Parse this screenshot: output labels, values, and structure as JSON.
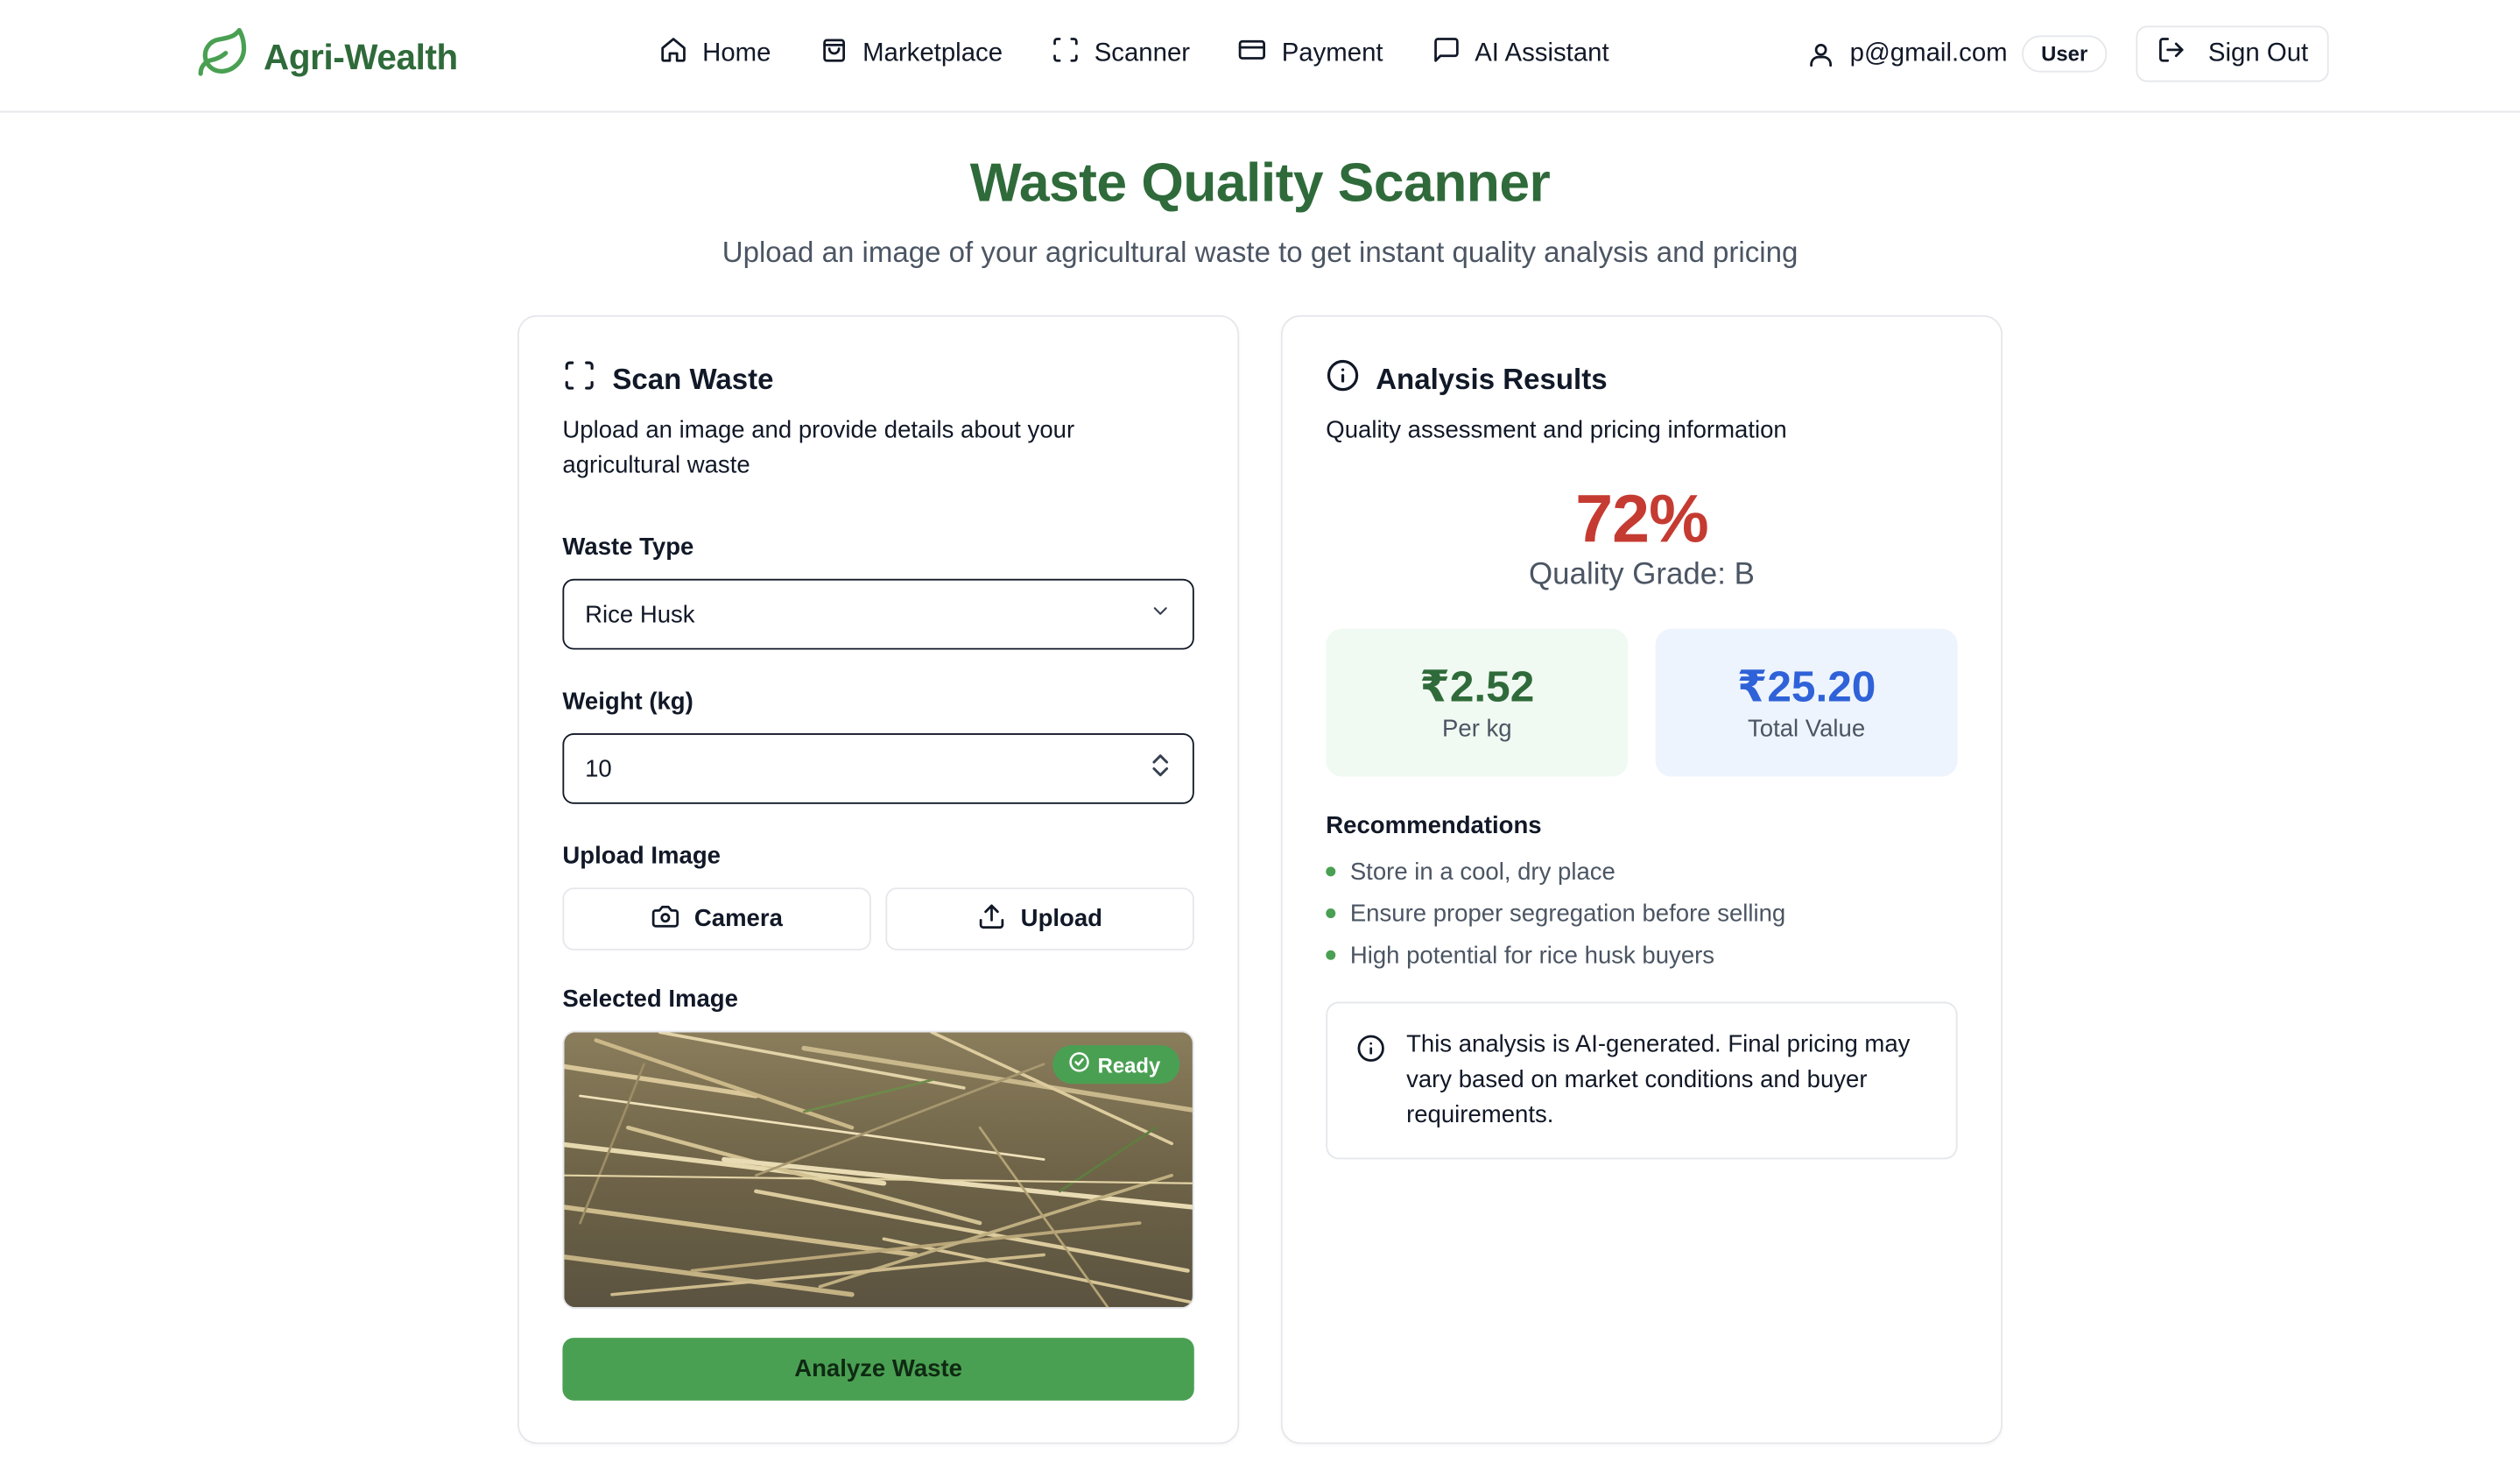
{
  "app": {
    "name": "Agri-Wealth"
  },
  "nav": {
    "items": [
      {
        "label": "Home",
        "icon": "home-icon"
      },
      {
        "label": "Marketplace",
        "icon": "shopping-bag-icon"
      },
      {
        "label": "Scanner",
        "icon": "scan-icon"
      },
      {
        "label": "Payment",
        "icon": "credit-card-icon"
      },
      {
        "label": "AI Assistant",
        "icon": "message-square-icon"
      }
    ]
  },
  "user": {
    "email": "p@gmail.com",
    "role": "User",
    "sign_out": "Sign Out"
  },
  "page": {
    "title": "Waste Quality Scanner",
    "subtitle": "Upload an image of your agricultural waste to get instant quality analysis and pricing"
  },
  "scan": {
    "title": "Scan Waste",
    "description": "Upload an image and provide details about your agricultural waste",
    "waste_type_label": "Waste Type",
    "waste_type_value": "Rice Husk",
    "weight_label": "Weight (kg)",
    "weight_value": "10",
    "upload_label": "Upload Image",
    "camera_button": "Camera",
    "upload_button": "Upload",
    "selected_label": "Selected Image",
    "ready_badge": "Ready",
    "analyze_button": "Analyze Waste"
  },
  "results": {
    "title": "Analysis Results",
    "description": "Quality assessment and pricing information",
    "score": "72%",
    "grade": "Quality Grade: B",
    "per_kg_value": "₹2.52",
    "per_kg_label": "Per kg",
    "total_value": "₹25.20",
    "total_label": "Total Value",
    "recommendations_label": "Recommendations",
    "recommendations": [
      "Store in a cool, dry place",
      "Ensure proper segregation before selling",
      "High potential for rice husk buyers"
    ],
    "notice": "This analysis is AI-generated. Final pricing may vary based on market conditions and buyer requirements."
  },
  "colors": {
    "brand_green": "#2f6b3a",
    "button_green": "#4aa052",
    "score_red": "#c53b32",
    "total_blue": "#2f62d8",
    "per_kg_bg": "#f0faf2",
    "total_bg": "#edf4fd"
  }
}
